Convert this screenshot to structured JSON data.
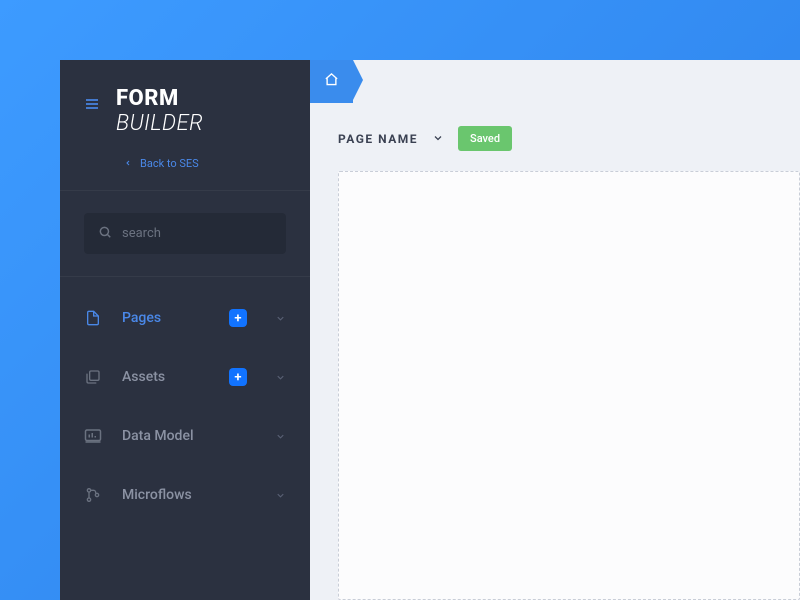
{
  "logo": {
    "top": "FORM",
    "bottom": "BUILDER"
  },
  "back_link": "Back to SES",
  "search": {
    "placeholder": "search"
  },
  "nav": {
    "items": [
      {
        "label": "Pages"
      },
      {
        "label": "Assets"
      },
      {
        "label": "Data Model"
      },
      {
        "label": "Microflows"
      }
    ]
  },
  "toolbar": {
    "page_name": "PAGE NAME",
    "status": "Saved"
  }
}
